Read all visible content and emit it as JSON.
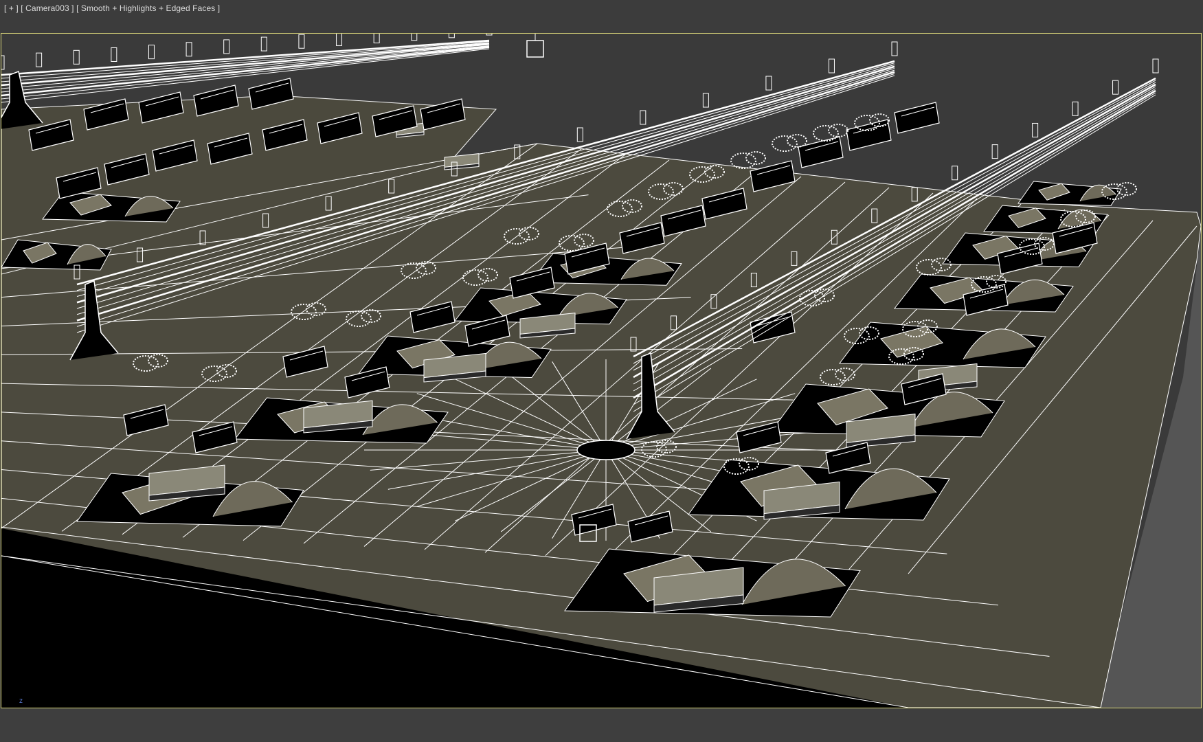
{
  "viewport": {
    "menu_plus": "[ + ]",
    "camera": "[ Camera003 ]",
    "shading": "[ Smooth + Highlights + Edged Faces ]",
    "axis_label": "z"
  },
  "colors": {
    "background": "#3a3a3a",
    "border_active": "#d9d67a",
    "slab_top": "#4c4a3e",
    "wire": "#ffffff",
    "shadow": "#000000"
  }
}
